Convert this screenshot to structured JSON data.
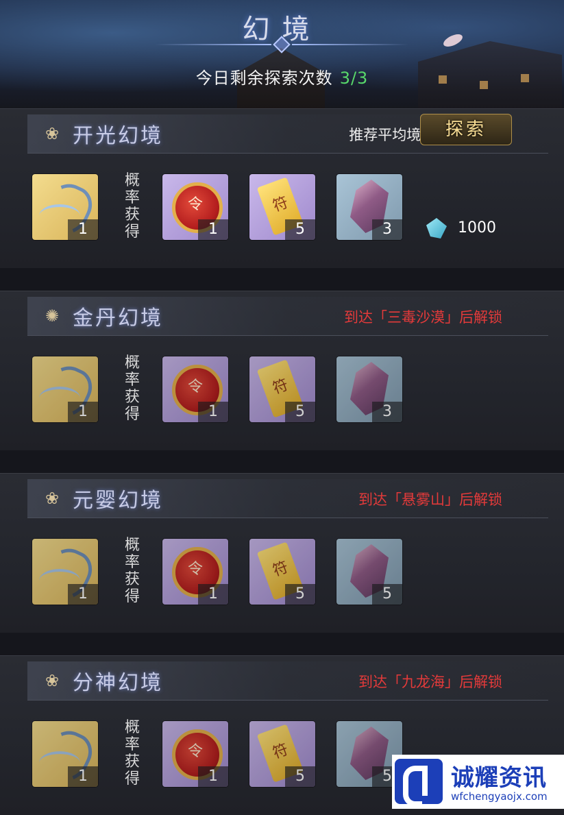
{
  "header": {
    "title": "幻境",
    "remaining_label": "今日剩余探索次数",
    "remaining_value": "3/3"
  },
  "probability_label": [
    "概",
    "率",
    "获",
    "得"
  ],
  "realms": [
    {
      "name": "开光幻境",
      "icon": "lotus-flame-icon",
      "right_text": "推荐平均境界: 开光前期",
      "locked": false,
      "rewards": [
        {
          "icon": "spirit-wisp-icon",
          "qty": "1"
        },
        {
          "icon": "red-medal-icon",
          "qty": "1"
        },
        {
          "icon": "gold-talisman-icon",
          "qty": "5"
        },
        {
          "icon": "purple-crystal-icon",
          "qty": "3"
        }
      ]
    },
    {
      "name": "金丹幻境",
      "icon": "sun-core-icon",
      "right_text": "到达「三毒沙漠」后解锁",
      "locked": true,
      "rewards": [
        {
          "icon": "spirit-wisp-icon",
          "qty": "1"
        },
        {
          "icon": "red-medal-icon",
          "qty": "1"
        },
        {
          "icon": "gold-talisman-icon",
          "qty": "5"
        },
        {
          "icon": "purple-crystal-icon",
          "qty": "3"
        }
      ]
    },
    {
      "name": "元婴幻境",
      "icon": "lotus-flame-icon",
      "right_text": "到达「悬雾山」后解锁",
      "locked": true,
      "rewards": [
        {
          "icon": "spirit-wisp-icon",
          "qty": "1"
        },
        {
          "icon": "red-medal-icon",
          "qty": "1"
        },
        {
          "icon": "gold-talisman-icon",
          "qty": "5"
        },
        {
          "icon": "purple-crystal-icon",
          "qty": "5"
        }
      ]
    },
    {
      "name": "分神幻境",
      "icon": "lotus-flame-icon",
      "right_text": "到达「九龙海」后解锁",
      "locked": true,
      "rewards": [
        {
          "icon": "spirit-wisp-icon",
          "qty": "1"
        },
        {
          "icon": "red-medal-icon",
          "qty": "1"
        },
        {
          "icon": "gold-talisman-icon",
          "qty": "5"
        },
        {
          "icon": "purple-crystal-icon",
          "qty": "5"
        }
      ]
    }
  ],
  "explore": {
    "button_label": "探索",
    "cost_icon": "spirit-gem-icon",
    "cost_value": "1000"
  },
  "watermark": {
    "brand": "诚耀资讯",
    "url": "wfchengyaojx.com"
  },
  "colors": {
    "accent_green": "#58d86a",
    "locked_red": "#e43a3a",
    "button_gold": "#f7dc93"
  }
}
